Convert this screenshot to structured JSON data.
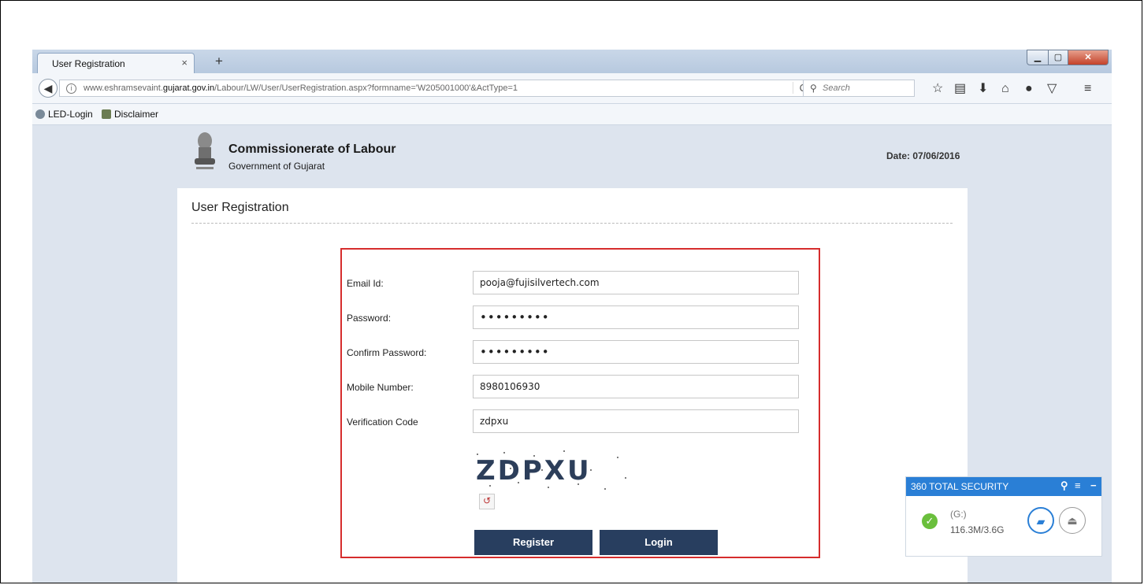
{
  "browser": {
    "tab_title": "User Registration",
    "tab_close": "×",
    "new_tab": "+",
    "url_prefix": "www.eshramsevaint.",
    "url_domain": "gujarat.gov.in",
    "url_path": "/Labour/LW/User/UserRegistration.aspx?formname='W205001000'&ActType=1",
    "search_placeholder": "Search",
    "bookmarks": [
      "LED-Login",
      "Disclaimer"
    ]
  },
  "header": {
    "org_name": "Commissionerate of Labour",
    "org_sub": "Government of Gujarat",
    "date": "Date: 07/06/2016"
  },
  "main": {
    "page_title": "User Registration",
    "fields": {
      "email_label": "Email Id:",
      "email_value": "pooja@fujisilvertech.com",
      "password_label": "Password:",
      "password_value": "•••••••••",
      "confirm_label": "Confirm Password:",
      "confirm_value": "•••••••••",
      "mobile_label": "Mobile Number:",
      "mobile_value": "8980106930",
      "verify_label": "Verification Code",
      "verify_value": "zdpxu"
    },
    "captcha_text": "ZDPXU",
    "register_label": "Register",
    "login_label": "Login"
  },
  "security": {
    "title": "360 TOTAL SECURITY",
    "drive": "(G:)",
    "size": "116.3M/3.6G"
  }
}
